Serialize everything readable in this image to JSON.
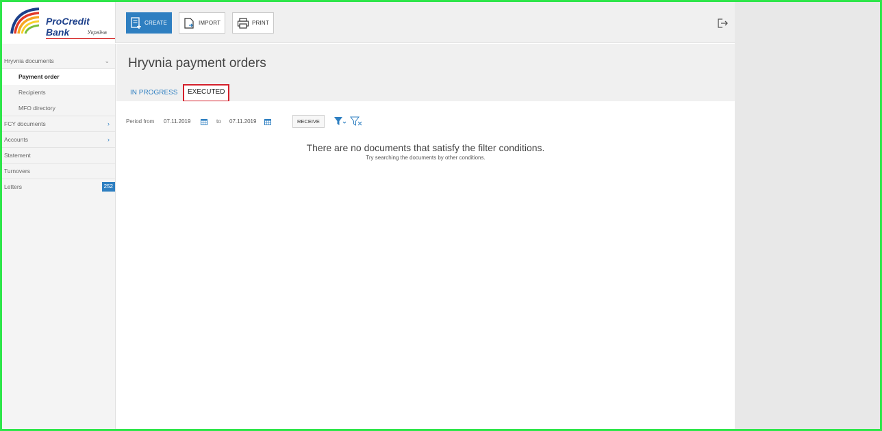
{
  "brand": {
    "name": "ProCredit Bank",
    "subtitle": "Україна"
  },
  "toolbar": {
    "create_label": "CREATE",
    "import_label": "IMPORT",
    "print_label": "PRINT"
  },
  "sidebar": {
    "items": [
      {
        "label": "Hryvnia documents",
        "arrow": "⌄"
      },
      {
        "label": "Payment order"
      },
      {
        "label": "Recipients"
      },
      {
        "label": "MFO directory"
      },
      {
        "label": "FCY documents",
        "arrow": "›"
      },
      {
        "label": "Accounts",
        "arrow": "›"
      },
      {
        "label": "Statement"
      },
      {
        "label": "Turnovers"
      },
      {
        "label": "Letters",
        "badge": "252"
      }
    ]
  },
  "page": {
    "title": "Hryvnia payment orders",
    "tabs": [
      {
        "label": "IN PROGRESS"
      },
      {
        "label": "EXECUTED"
      }
    ]
  },
  "filters": {
    "period_from_label": "Period from",
    "date_from": "07.11.2019",
    "to_label": "to",
    "date_to": "07.11.2019",
    "receive_label": "RECEIVE"
  },
  "empty_state": {
    "message": "There are no documents that satisfy the filter conditions.",
    "hint": "Try searching the documents by other conditions."
  },
  "colors": {
    "accent": "#2e7fc1",
    "highlight_border": "#d41f2a",
    "frame": "#2ee64a"
  }
}
